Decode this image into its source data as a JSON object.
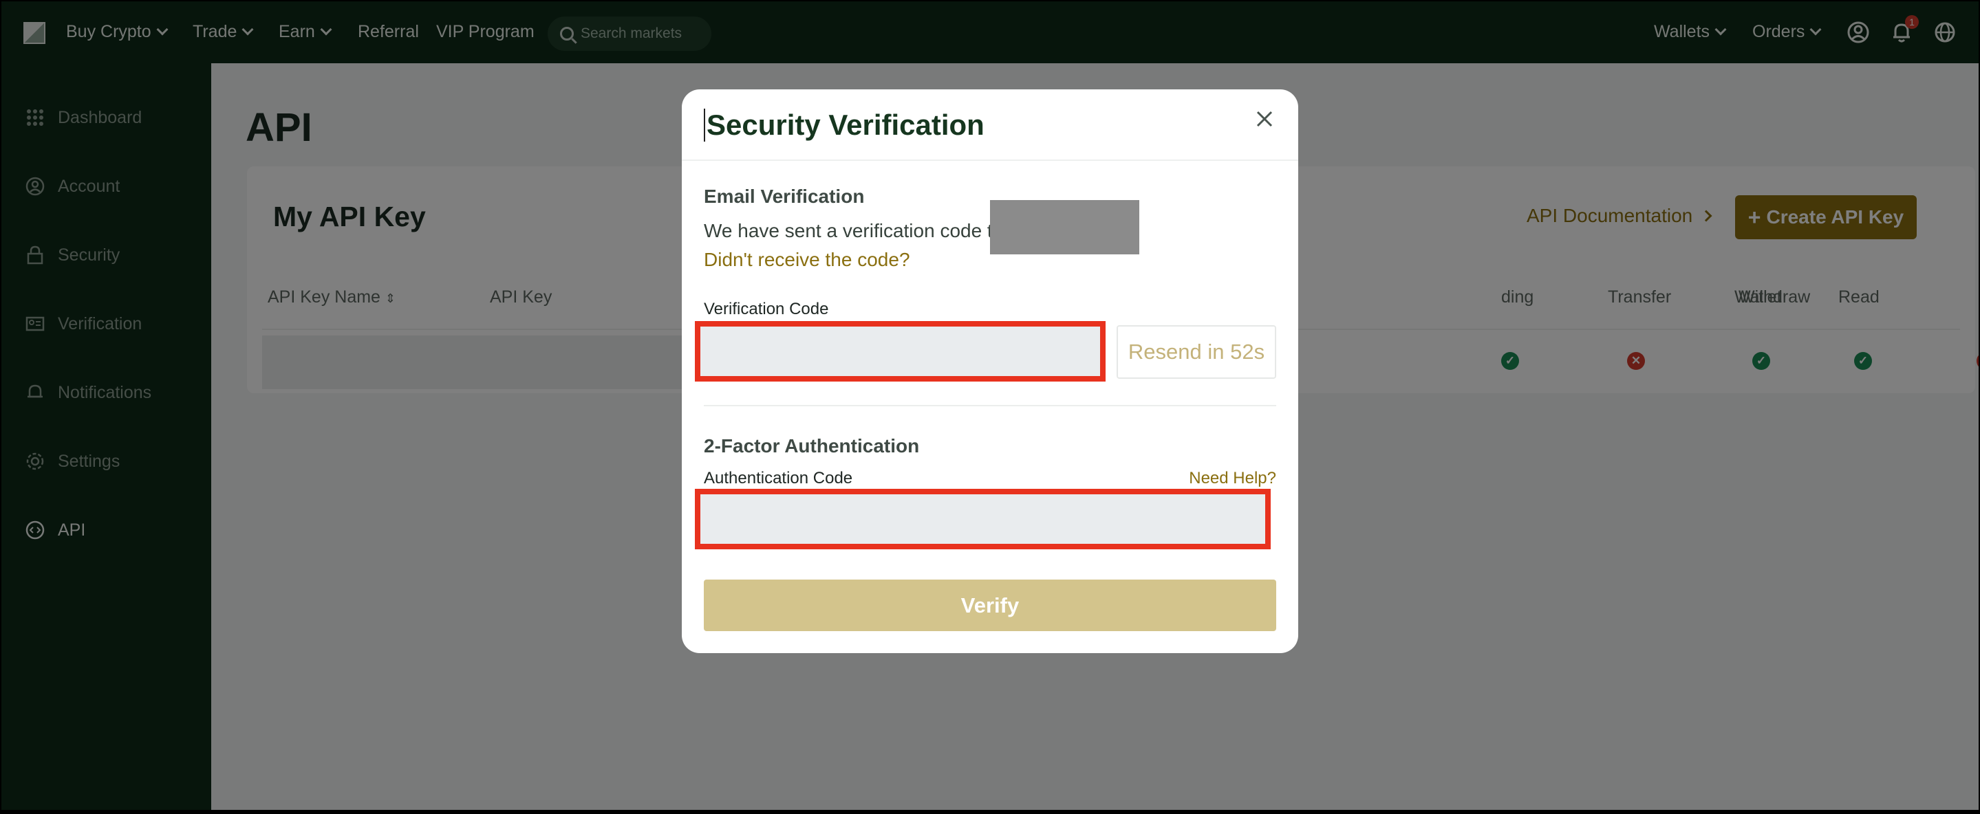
{
  "nav": {
    "buy_crypto": "Buy Crypto",
    "trade": "Trade",
    "earn": "Earn",
    "referral": "Referral",
    "vip": "VIP Program",
    "search_placeholder": "Search markets",
    "wallets": "Wallets",
    "orders": "Orders",
    "notification_count": "1"
  },
  "sidebar": {
    "items": [
      {
        "label": "Dashboard",
        "icon": "grid-icon"
      },
      {
        "label": "Account",
        "icon": "user-icon"
      },
      {
        "label": "Security",
        "icon": "lock-icon"
      },
      {
        "label": "Verification",
        "icon": "id-card-icon"
      },
      {
        "label": "Notifications",
        "icon": "bell-icon"
      },
      {
        "label": "Settings",
        "icon": "gear-icon"
      },
      {
        "label": "API",
        "icon": "code-icon"
      }
    ],
    "active": "API"
  },
  "main": {
    "title": "API",
    "card_title": "My API Key",
    "api_doc_link": "API Documentation",
    "create_button": "Create API Key",
    "columns": [
      "API Key Name",
      "API Key",
      "ding",
      "Transfer",
      "Wallet",
      "Read",
      "Withdraw"
    ],
    "row_status": {
      "ding": "ok",
      "Transfer": "no",
      "Wallet": "ok",
      "Read": "ok",
      "Withdraw": "no"
    }
  },
  "modal": {
    "title": "Security Verification",
    "email_section": "Email Verification",
    "sent_text": "We have sent a verification code to",
    "no_code_link": "Didn't receive the code?",
    "verification_label": "Verification Code",
    "verification_value": "",
    "resend_label": "Resend in 52s",
    "twofa_section": "2-Factor Authentication",
    "auth_label": "Authentication Code",
    "need_help": "Need Help?",
    "auth_value": "",
    "verify_button": "Verify"
  },
  "colors": {
    "nav_bg": "#0f2a18",
    "accent_gold": "#8a6f10",
    "verify_disabled": "#d3c48c",
    "highlight_red": "#e8321e",
    "ok_green": "#1a8a55",
    "no_red": "#d33b2c"
  }
}
